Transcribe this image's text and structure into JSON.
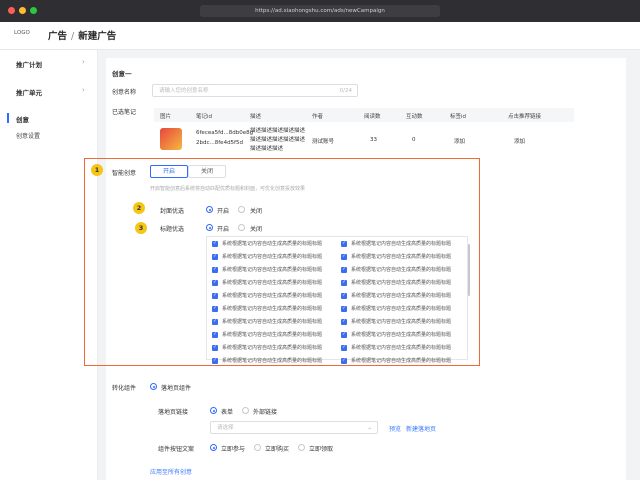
{
  "browser": {
    "url": "https://ad.xiaohongshu.com/ads/newCampaign",
    "dot_colors": [
      "#ff5f57",
      "#febc2e",
      "#28c840"
    ]
  },
  "header": {
    "logo": "LOGO",
    "crumb_parent": "广告",
    "crumb_sep": "/",
    "crumb_current": "新建广告"
  },
  "sidebar": {
    "items": [
      {
        "label": "推广计划"
      },
      {
        "label": "推广单元"
      },
      {
        "label": "创意"
      },
      {
        "label": "创意设置"
      }
    ]
  },
  "creative": {
    "section_title": "创意一",
    "name_label": "创意名称",
    "name_placeholder": "请输入您的创意名称",
    "name_counter": "0/24",
    "notes_label": "已选笔记",
    "table": {
      "headers": [
        "图片",
        "笔记id",
        "描述",
        "作者",
        "阅读数",
        "互动数",
        "标签id",
        "点击推荐链接"
      ],
      "row": {
        "note_id_1": "6fecea5fd...8db0e8g",
        "note_id_2": "2bdc...8fe4d5f5d",
        "desc_1": "描述描述描述描述描述",
        "desc_2": "描述描述描述描述描述",
        "desc_3": "描述描述描述",
        "author": "测试账号",
        "reads": "33",
        "interactions": "0",
        "tag_link": "添加",
        "rec_link": "添加"
      }
    }
  },
  "smart": {
    "badge1": "1",
    "badge2": "2",
    "badge3": "3",
    "label": "智能创意",
    "on": "开启",
    "off": "关闭",
    "hint": "开启智能创意后系统将自动匹配优质标题和封面，可优化创意投放效果",
    "cover_label": "封面优选",
    "cover_on": "开启",
    "cover_off": "关闭",
    "title_label": "标题优选",
    "title_on": "开启",
    "title_off": "关闭",
    "option_text": "系统根据笔记内容自动生成高质量的标题标题",
    "check": "✓"
  },
  "conversion": {
    "label": "转化组件",
    "landing_option": "落地页组件",
    "landing_link_label": "落地页链接",
    "form": "表单",
    "external_link": "外部链接",
    "select_placeholder": "请选择",
    "preview": "预览",
    "new_landing": "新建落地页",
    "button_text_label": "组件按钮文案",
    "btn_opt1": "立即参与",
    "btn_opt2": "立即购买",
    "btn_opt3": "立即领取",
    "apply_all": "应用至所有创意"
  }
}
